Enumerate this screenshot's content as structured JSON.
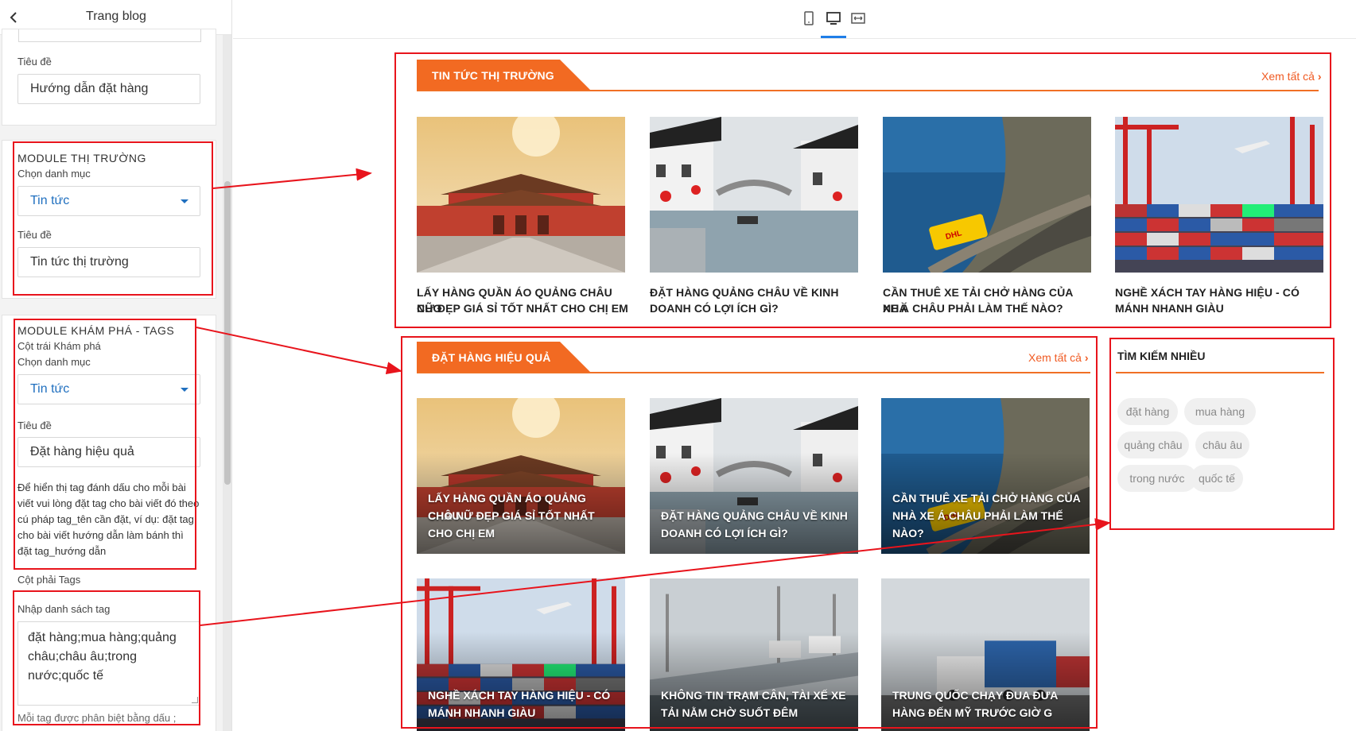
{
  "panel": {
    "title": "Trang blog",
    "card1": {
      "title_label": "Tiêu đề",
      "title_value": "Hướng dẫn đặt hàng"
    },
    "market_module": {
      "heading": "MODULE THỊ TRƯỜNG",
      "category_label": "Chọn danh mục",
      "category_value": "Tin tức",
      "title_label": "Tiêu đề",
      "title_value": "Tin tức thị trường"
    },
    "explore_module": {
      "heading": "MODULE KHÁM PHÁ - TAGS",
      "left_col_label": "Cột trái Khám phá",
      "category_label": "Chọn danh mục",
      "category_value": "Tin tức",
      "title_label": "Tiêu đề",
      "title_value": "Đặt hàng hiệu quả",
      "note": "Để hiển thị tag đánh dấu cho mỗi bài viết vui lòng đặt tag cho bài viết đó theo cú pháp tag_tên cần đặt, ví dụ: đặt tag cho bài viết hướng dẫn làm bánh thì đặt tag_hướng dẫn",
      "right_col_label": "Cột phải Tags",
      "tags_label": "Nhập danh sách tag",
      "tags_value": "đặt hàng;mua hàng;quảng châu;châu âu;trong nước;quốc tế",
      "tags_hint": "Mỗi tag được phân biệt bằng dấu ;"
    }
  },
  "toolbar": {
    "icons": [
      "mobile-icon",
      "desktop-icon",
      "full-width-icon"
    ],
    "active": "desktop-icon",
    "accent_color": "#1f7ee8"
  },
  "preview": {
    "accent_color": "#f07025",
    "market_section": {
      "heading": "TIN TỨC THỊ TRƯỜNG",
      "see_all": "Xem tất cả",
      "posts": [
        {
          "image": "forbidden-city",
          "title_l1": "LẤY HÀNG QUẦN ÁO QUẢNG CHÂU CHO",
          "title_l2": "NỮ ĐẸP GIÁ SỈ TỐT NHẤT CHO CHỊ EM"
        },
        {
          "image": "water-town",
          "title_l1": "ĐẶT HÀNG QUẢNG CHÂU VỀ KINH",
          "title_l2": "DOANH CÓ LỢI ÍCH GÌ?"
        },
        {
          "image": "dhl-van-coast",
          "title_l1": "CẦN THUÊ XE TẢI CHỞ HÀNG CỦA NHÀ",
          "title_l2": "XE Á CHÂU PHẢI LÀM THẾ NÀO?"
        },
        {
          "image": "container-port",
          "title_l1": "NGHỀ XÁCH TAY HÀNG HIỆU - CÓ",
          "title_l2": "MÁNH NHANH GIÀU"
        }
      ]
    },
    "explore_section": {
      "heading": "ĐẶT HÀNG HIỆU QUẢ",
      "see_all": "Xem tất cả",
      "posts": [
        {
          "image": "forbidden-city",
          "l1": "LẤY HÀNG QUẦN ÁO QUẢNG CHÂU",
          "l2": "CHO NỮ ĐẸP GIÁ SỈ TỐT NHẤT",
          "l3": "CHO CHỊ EM"
        },
        {
          "image": "water-town",
          "l1": "ĐẶT HÀNG QUẢNG CHÂU VỀ KINH",
          "l2": "DOANH CÓ LỢI ÍCH GÌ?",
          "l3": ""
        },
        {
          "image": "dhl-van-coast",
          "l1": "CẦN THUÊ XE TẢI CHỞ HÀNG CỦA",
          "l2": "NHÀ XE Á CHÂU PHẢI LÀM THẾ",
          "l3": "NÀO?"
        },
        {
          "image": "container-port",
          "l1": "NGHỀ XÁCH TAY HÀNG HIỆU - CÓ",
          "l2": "MÁNH NHANH GIÀU",
          "l3": ""
        },
        {
          "image": "highway-trucks",
          "l1": "KHÔNG TIN TRẠM CÂN, TÀI XẾ XE",
          "l2": "TẢI NẰM CHỜ SUỐT ĐÊM",
          "l3": ""
        },
        {
          "image": "truck-convoy",
          "l1": "TRUNG QUỐC CHẠY ĐUA ĐƯA",
          "l2": "HÀNG ĐẾN MỸ TRƯỚC GIỜ G",
          "l3": ""
        }
      ]
    },
    "sidebar": {
      "heading": "TÌM KIẾM NHIỀU",
      "tags": [
        "đặt hàng",
        "mua hàng",
        "quảng châu",
        "châu âu",
        "trong nước",
        "quốc tế"
      ]
    }
  },
  "annotation_color": "#e8141c"
}
